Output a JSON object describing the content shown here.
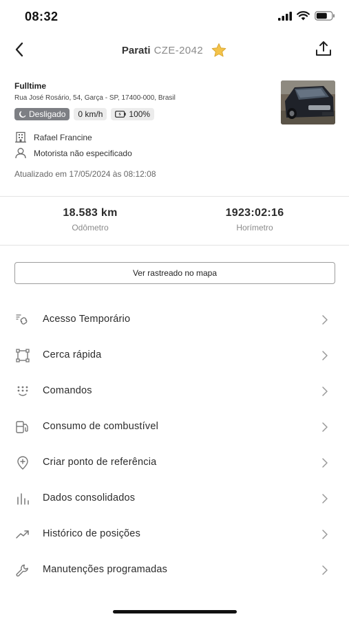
{
  "status_bar": {
    "time": "08:32"
  },
  "nav": {
    "model": "Parati",
    "plate": "CZE-2042"
  },
  "vehicle": {
    "contract": "Fulltime",
    "address": "Rua José Rosário, 54, Garça - SP, 17400-000, Brasil",
    "ignition": "Desligado",
    "speed": "0 km/h",
    "battery": "100%",
    "client": "Rafael Francine",
    "driver": "Motorista não especificado",
    "updated": "Atualizado em 17/05/2024 às 08:12:08"
  },
  "stats": {
    "odometer_value": "18.583 km",
    "odometer_label": "Odômetro",
    "hourmeter_value": "1923:02:16",
    "hourmeter_label": "Horímetro"
  },
  "map_button": {
    "label": "Ver rastreado no mapa"
  },
  "menu": {
    "items": [
      {
        "label": "Acesso Temporário",
        "icon": "link-icon"
      },
      {
        "label": "Cerca rápida",
        "icon": "fence-icon"
      },
      {
        "label": "Comandos",
        "icon": "keypad-icon"
      },
      {
        "label": "Consumo de combustível",
        "icon": "fuel-pump-icon"
      },
      {
        "label": "Criar ponto de referência",
        "icon": "location-add-icon"
      },
      {
        "label": "Dados consolidados",
        "icon": "bar-chart-icon"
      },
      {
        "label": "Histórico de posições",
        "icon": "trending-icon"
      },
      {
        "label": "Manutenções programadas",
        "icon": "wrench-icon"
      }
    ]
  },
  "colors": {
    "badge_gray": "#7d7f84",
    "star": "#f4c34a",
    "text": "#2b2b2b",
    "muted": "#8a8a8a"
  }
}
